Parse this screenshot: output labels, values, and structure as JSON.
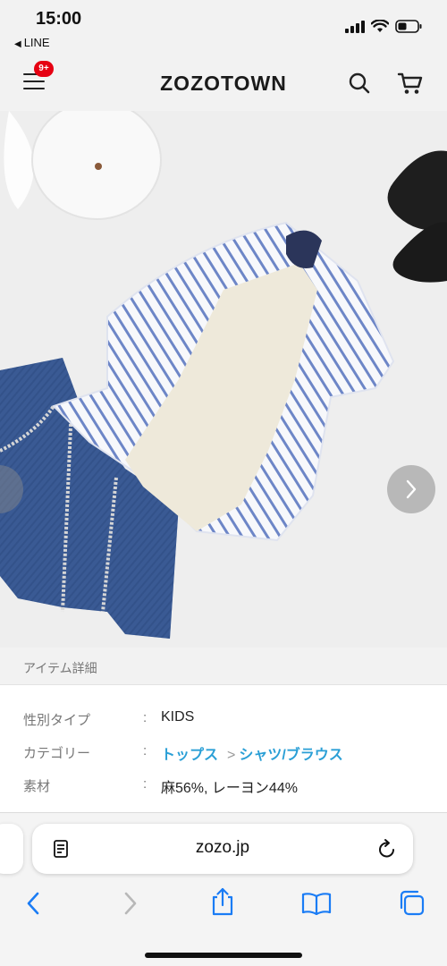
{
  "status_bar": {
    "time": "15:00",
    "back_app": "LINE"
  },
  "header": {
    "logo": "ZOZOTOWN",
    "notification_badge": "9+"
  },
  "product": {
    "image_icon": "outfit-photo"
  },
  "item_details": {
    "section_title": "アイテム詳細",
    "rows": [
      {
        "label": "性別タイプ",
        "value": "KIDS"
      },
      {
        "label": "カテゴリー",
        "category": "トップス",
        "subcategory": "シャツ/ブラウス"
      },
      {
        "label": "素材",
        "value": "麻56%, レーヨン44%"
      }
    ]
  },
  "browser": {
    "url": "zozo.jp"
  },
  "colors": {
    "badge": "#e60012",
    "link": "#2a9fd6",
    "ios_blue": "#1a7cf5"
  }
}
